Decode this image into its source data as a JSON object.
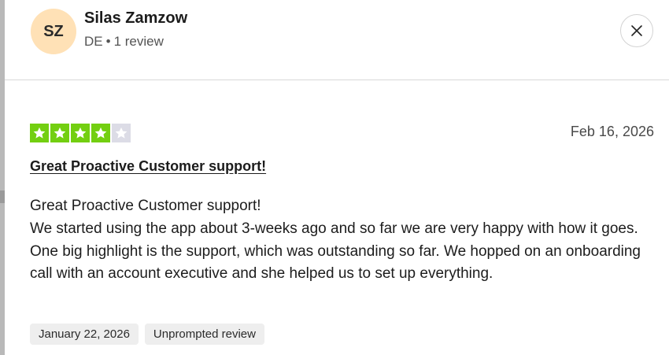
{
  "reviewer": {
    "initials": "SZ",
    "name": "Silas Zamzow",
    "country": "DE",
    "separator": "•",
    "review_count": "1 review"
  },
  "close_icon": "close-icon",
  "review": {
    "rating": 4,
    "max_rating": 5,
    "date": "Feb 16, 2026",
    "title": "Great Proactive Customer support!",
    "body_lines": [
      "Great Proactive Customer support!",
      "We started using the app about 3-weeks ago and so far we are very happy with how it goes. One big highlight is the support, which was outstanding so far. We hopped on an onboarding call with an account executive and she helped us to set up everything."
    ],
    "tags": [
      "January 22, 2026",
      "Unprompted review"
    ]
  },
  "colors": {
    "star_filled": "#73cf11",
    "star_empty": "#dcdce6",
    "avatar_bg": "#ffe1b6",
    "tag_bg": "#eeeeee"
  }
}
